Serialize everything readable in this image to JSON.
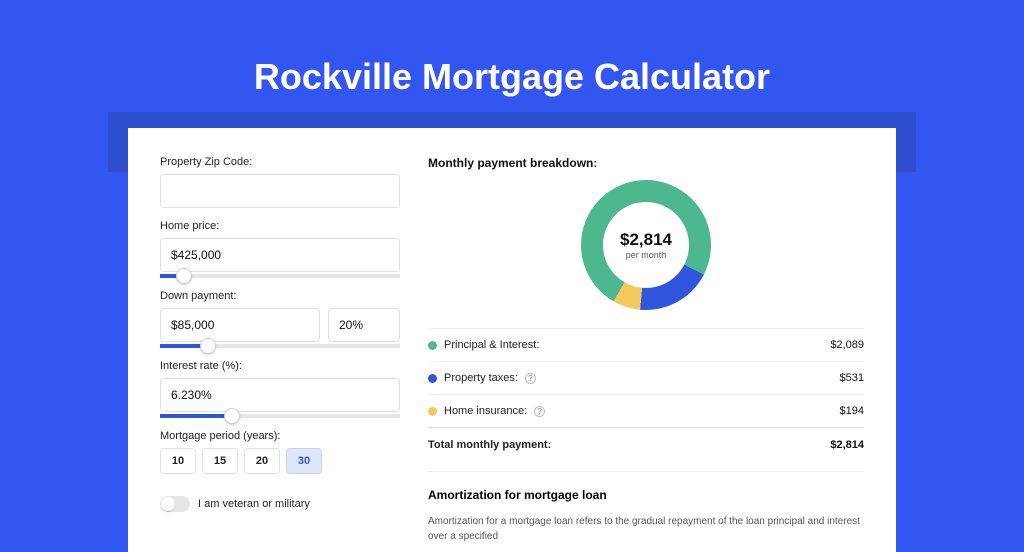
{
  "title": "Rockville Mortgage Calculator",
  "form": {
    "zip_label": "Property Zip Code:",
    "zip_value": "",
    "home_price_label": "Home price:",
    "home_price_value": "$425,000",
    "home_price_slider_pct": 10,
    "down_payment_label": "Down payment:",
    "down_payment_value": "$85,000",
    "down_payment_pct": "20%",
    "down_payment_slider_pct": 20,
    "interest_label": "Interest rate (%):",
    "interest_value": "6.230%",
    "interest_slider_pct": 30,
    "period_label": "Mortgage period (years):",
    "periods": [
      "10",
      "15",
      "20",
      "30"
    ],
    "period_selected": "30",
    "veteran_label": "I am veteran or military"
  },
  "breakdown": {
    "title": "Monthly payment breakdown:",
    "center_amount": "$2,814",
    "center_sub": "per month",
    "items": [
      {
        "label": "Principal & Interest:",
        "value": "$2,089",
        "info": false
      },
      {
        "label": "Property taxes:",
        "value": "$531",
        "info": true
      },
      {
        "label": "Home insurance:",
        "value": "$194",
        "info": true
      }
    ],
    "total_label": "Total monthly payment:",
    "total_value": "$2,814"
  },
  "chart_data": {
    "type": "pie",
    "title": "Monthly payment breakdown",
    "categories": [
      "Principal & Interest",
      "Property taxes",
      "Home insurance"
    ],
    "values": [
      2089,
      531,
      194
    ],
    "colors": [
      "#4db88f",
      "#2f55dc",
      "#f4c95d"
    ],
    "center_label": "$2,814 per month"
  },
  "amortization": {
    "title": "Amortization for mortgage loan",
    "body": "Amortization for a mortgage loan refers to the gradual repayment of the loan principal and interest over a specified"
  }
}
